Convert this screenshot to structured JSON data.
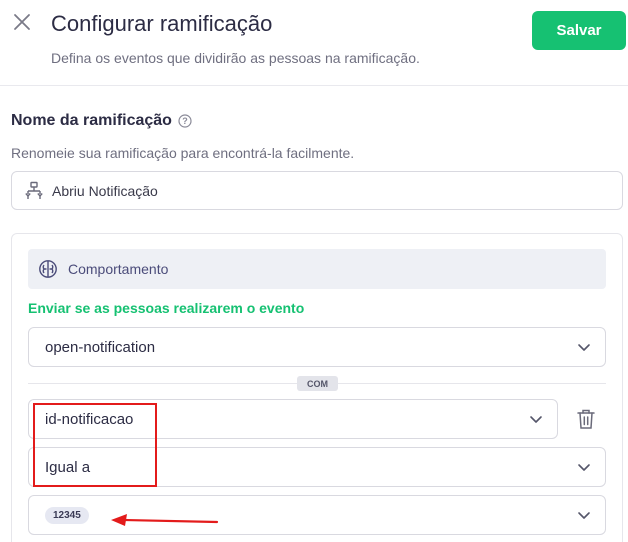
{
  "header": {
    "title": "Configurar ramificação",
    "subtitle": "Defina os eventos que dividirão as pessoas na ramificação.",
    "save_label": "Salvar",
    "close_icon": "close-icon"
  },
  "name_section": {
    "title": "Nome da ramificação",
    "help_icon": "help-icon",
    "description": "Renomeie sua ramificação para encontrá-la facilmente.",
    "field_value": "Abriu Notificação",
    "field_icon": "branch-icon"
  },
  "behavior": {
    "label": "Comportamento",
    "icon": "brain-icon",
    "event_label": "Enviar se as pessoas realizarem o evento",
    "event_value": "open-notification",
    "connector": "COM",
    "attribute_value": "id-notificacao",
    "operator_value": "Igual a",
    "value_chip": "12345"
  },
  "colors": {
    "accent_green": "#16c172",
    "annotation_red": "#e31b1b"
  }
}
